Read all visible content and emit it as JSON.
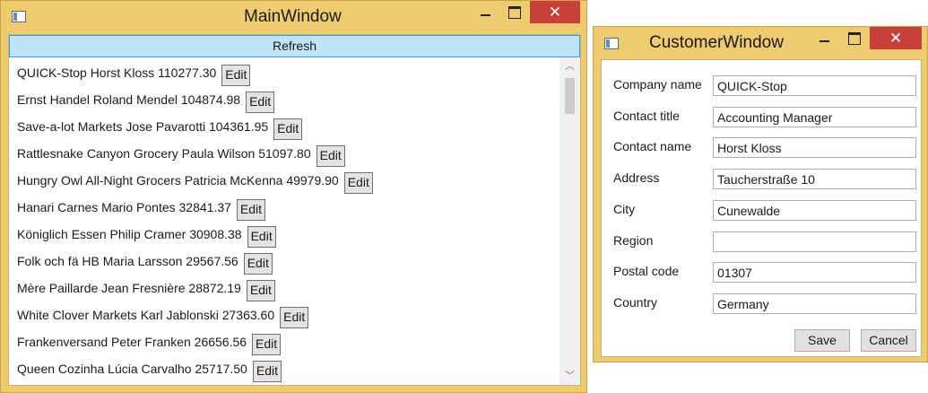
{
  "main_window": {
    "title": "MainWindow",
    "controls": {
      "minimize": "",
      "maximize": "",
      "close": "✕"
    },
    "refresh_label": "Refresh",
    "edit_label": "Edit",
    "customers": [
      {
        "text": "QUICK-Stop Horst Kloss  110277.30"
      },
      {
        "text": "Ernst Handel Roland Mendel  104874.98"
      },
      {
        "text": "Save-a-lot Markets Jose Pavarotti  104361.95"
      },
      {
        "text": "Rattlesnake Canyon Grocery Paula Wilson  51097.80"
      },
      {
        "text": "Hungry Owl All-Night Grocers Patricia McKenna  49979.90"
      },
      {
        "text": "Hanari Carnes Mario Pontes  32841.37"
      },
      {
        "text": "Königlich Essen Philip Cramer  30908.38"
      },
      {
        "text": "Folk och fä HB Maria Larsson  29567.56"
      },
      {
        "text": "Mère Paillarde Jean Fresnière  28872.19"
      },
      {
        "text": "White Clover Markets Karl Jablonski  27363.60"
      },
      {
        "text": "Frankenversand Peter Franken  26656.56"
      },
      {
        "text": "Queen Cozinha Lúcia Carvalho  25717.50"
      }
    ],
    "scrollbar": {
      "up": "︿",
      "down": "﹀"
    }
  },
  "customer_window": {
    "title": "CustomerWindow",
    "controls": {
      "minimize": "",
      "maximize": "",
      "close": "✕"
    },
    "fields": [
      {
        "label": "Company name",
        "value": "QUICK-Stop"
      },
      {
        "label": "Contact title",
        "value": "Accounting Manager"
      },
      {
        "label": "Contact name",
        "value": "Horst Kloss"
      },
      {
        "label": "Address",
        "value": "Taucherstraße 10"
      },
      {
        "label": "City",
        "value": "Cunewalde"
      },
      {
        "label": "Region",
        "value": ""
      },
      {
        "label": "Postal code",
        "value": "01307"
      },
      {
        "label": "Country",
        "value": "Germany"
      }
    ],
    "save_label": "Save",
    "cancel_label": "Cancel"
  },
  "colors": {
    "window_frame": "#eecb6f",
    "close_button": "#c7403a",
    "refresh_button": "#bfe3f7",
    "refresh_border": "#3c9ad6"
  }
}
